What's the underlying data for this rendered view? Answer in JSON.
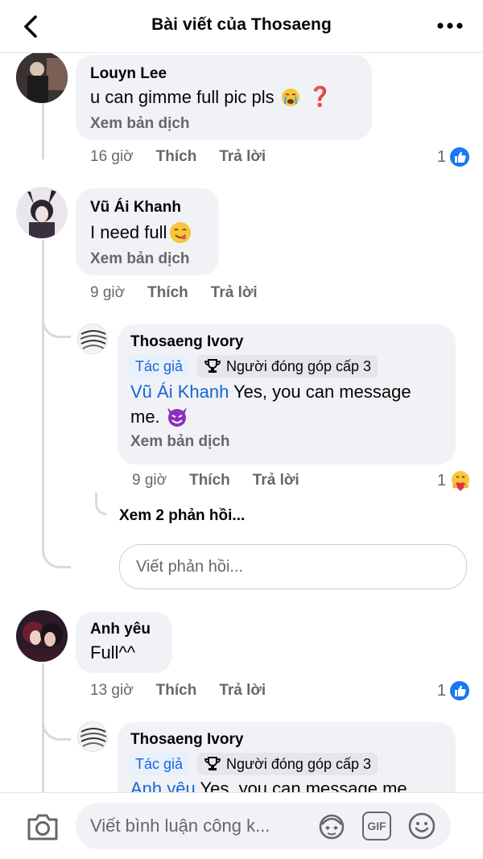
{
  "header": {
    "title": "Bài viết của Thosaeng"
  },
  "comments": [
    {
      "name": "Louyn Lee",
      "text": "u can gimme full pic pls",
      "translate": "Xem bản dịch",
      "time": "16 giờ",
      "like": "Thích",
      "reply": "Trả lời",
      "reaction_count": "1",
      "reaction_icon": "like-icon"
    },
    {
      "name": "Vũ Ái Khanh",
      "text": "I need full",
      "translate": "Xem bản dịch",
      "time": "9 giờ",
      "like": "Thích",
      "reply": "Trả lời",
      "replies": [
        {
          "name": "Thosaeng Ivory",
          "badge_author": "Tác giả",
          "badge_contributor": "Người đóng góp cấp 3",
          "mention": "Vũ Ái Khanh",
          "text_line1": " Yes, you can message",
          "text_line2": "me.",
          "translate": "Xem bản dịch",
          "time": "9 giờ",
          "like": "Thích",
          "reply": "Trả lời",
          "reaction_count": "1",
          "reaction_icon": "care-icon"
        }
      ],
      "view_more_replies": "Xem 2 phản hồi...",
      "reply_placeholder": "Viết phản hồi..."
    },
    {
      "name": "Anh yêu",
      "text": "Full^^",
      "time": "13 giờ",
      "like": "Thích",
      "reply": "Trả lời",
      "reaction_count": "1",
      "reaction_icon": "like-icon",
      "replies": [
        {
          "name": "Thosaeng Ivory",
          "badge_author": "Tác giả",
          "badge_contributor": "Người đóng góp cấp 3",
          "mention": "Anh yêu",
          "text_line1": " Yes, you can message me"
        }
      ]
    }
  ],
  "bottom_bar": {
    "comment_placeholder": "Viết bình luận công k...",
    "gif_label": "GIF"
  },
  "colors": {
    "accent": "#1b64d6",
    "like_blue": "#1877f2",
    "bubble": "#f0f2f5",
    "secondary_text": "#65676b"
  }
}
